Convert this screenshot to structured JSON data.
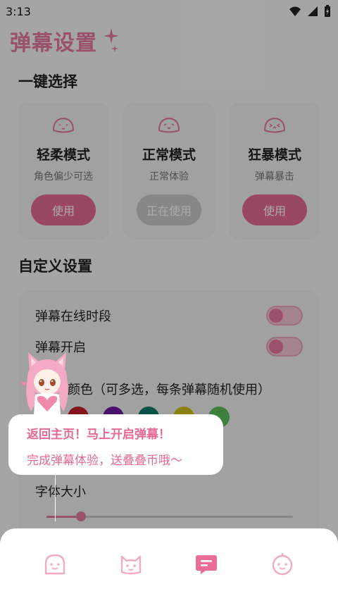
{
  "status_bar": {
    "time": "3:13"
  },
  "header": {
    "title": "弹幕设置"
  },
  "quick_select": {
    "title": "一键选择",
    "modes": [
      {
        "name": "轻柔模式",
        "desc": "角色偏少可选",
        "button": "使用",
        "active": false
      },
      {
        "name": "正常模式",
        "desc": "正常体验",
        "button": "正在使用",
        "active": true
      },
      {
        "name": "狂暴模式",
        "desc": "弹幕暴击",
        "button": "使用",
        "active": false
      }
    ]
  },
  "custom": {
    "title": "自定义设置",
    "online_period_label": "弹幕在线时段",
    "danmaku_enabled_label": "弹幕开启",
    "color_label": "颜色（可多选，每条弹幕随机使用）",
    "colors": [
      "#c41f2b",
      "#6b1aa3",
      "#0f7a6c",
      "#cfc21a",
      "#5bbf5a"
    ],
    "font_size_label": "字体大小",
    "font_size_value": 0.14
  },
  "toast": {
    "title": "返回主页！马上开启弹幕！",
    "subtitle": "完成弹幕体验，送叠叠币哦～"
  },
  "bottom_nav": {
    "items": [
      {
        "icon": "face-smile-icon",
        "active": false
      },
      {
        "icon": "cat-icon",
        "active": false
      },
      {
        "icon": "danmaku-message-icon",
        "active": true
      },
      {
        "icon": "face-happy-icon",
        "active": false
      }
    ]
  },
  "colors": {
    "brand_pink": "#e57aa1",
    "button_pink": "#e56b93",
    "disabled_gray": "#c9c9c9"
  }
}
